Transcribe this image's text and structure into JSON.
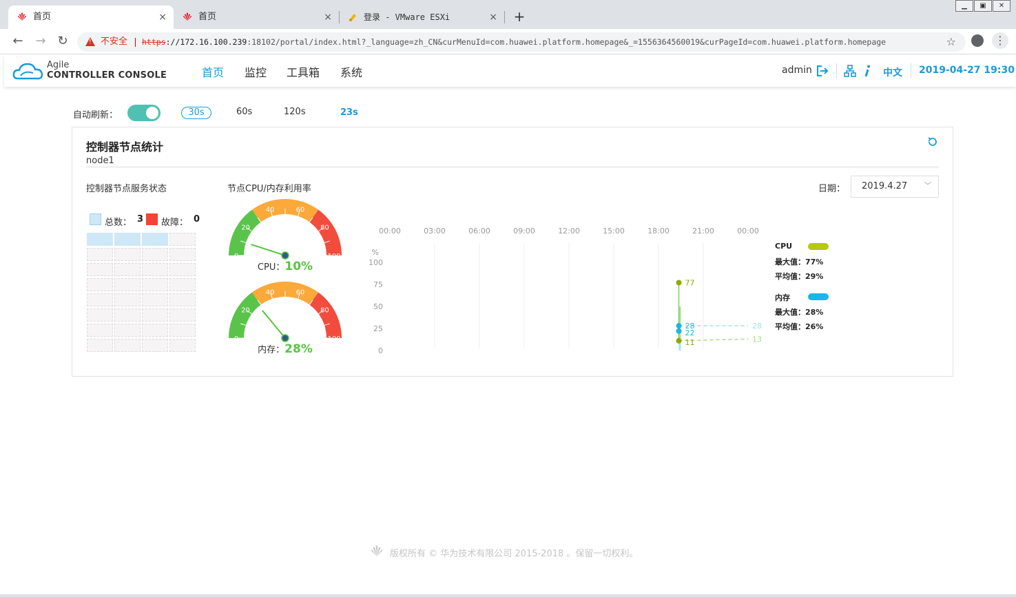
{
  "browser": {
    "tabs": [
      {
        "title": "首页",
        "active": true,
        "icon": "huawei-logo-icon"
      },
      {
        "title": "首页",
        "active": false,
        "icon": "huawei-logo-icon"
      },
      {
        "title": "登录 - VMware ESXi",
        "active": false,
        "icon": "vmware-icon"
      }
    ],
    "close_glyph": "×",
    "new_tab_glyph": "+",
    "security_label": "不安全",
    "url_scheme": "https",
    "url_host": "://172.16.100.239",
    "url_rest": ":18102/portal/index.html?_language=zh_CN&curMenuId=com.huawei.platform.homepage&_=1556364560019&curPageId=com.huawei.platform.homepage",
    "back_glyph": "←",
    "forward_glyph": "→",
    "reload_glyph": "↻",
    "star_glyph": "☆",
    "menu_glyph": "⋮"
  },
  "app": {
    "brand_line1": "Agile",
    "brand_line2": "CONTROLLER CONSOLE",
    "nav": [
      {
        "label": "首页",
        "active": true
      },
      {
        "label": "监控",
        "active": false
      },
      {
        "label": "工具箱",
        "active": false
      },
      {
        "label": "系统",
        "active": false
      }
    ],
    "user": "admin",
    "language": "中文",
    "datetime": "2019-04-27 19:30",
    "accent_color": "#1a9bd7"
  },
  "refresh": {
    "label": "自动刷新：",
    "enabled": true,
    "intervals": [
      "30s",
      "60s",
      "120s"
    ],
    "selected": "30s",
    "countdown": "23s"
  },
  "panel": {
    "title": "控制器节点统计",
    "node": "node1",
    "service_title": "控制器节点服务状态",
    "usage_title": "节点CPU/内存利用率",
    "date_label": "日期：",
    "date_value": "2019.4.27",
    "total_label": "总数：",
    "total": "3",
    "fault_label": "故障：",
    "fault": "0",
    "colors": {
      "total": "#cfe8f7",
      "fault": "#f44336"
    }
  },
  "gauges": [
    {
      "name": "CPU",
      "label": "CPU：",
      "value_text": "10%",
      "value": 10
    },
    {
      "name": "memory",
      "label": "内存：",
      "value_text": "28%",
      "value": 28
    }
  ],
  "gauge_ticks": [
    "0",
    "20",
    "40",
    "60",
    "80",
    "100"
  ],
  "chart_data": {
    "type": "line",
    "x_ticks": [
      "00:00",
      "03:00",
      "06:00",
      "09:00",
      "12:00",
      "15:00",
      "18:00",
      "21:00",
      "00:00"
    ],
    "y_unit": "%",
    "y_ticks": [
      "0",
      "25",
      "50",
      "75",
      "100"
    ],
    "ylim": [
      0,
      100
    ],
    "series": [
      {
        "name": "CPU",
        "color": "#b5c90e",
        "max_label": "最大值：77%",
        "avg_label": "平均值：29%",
        "points": [
          [
            "19:30",
            77
          ],
          [
            "19:30",
            11
          ]
        ],
        "dashed_to": 13,
        "labels": [
          "77",
          "11",
          "13"
        ]
      },
      {
        "name": "内存",
        "color": "#1ab6e8",
        "max_label": "最大值：28%",
        "avg_label": "平均值：26%",
        "points": [
          [
            "19:30",
            28
          ],
          [
            "19:30",
            22
          ]
        ],
        "dashed_to": 28,
        "labels": [
          "28",
          "22",
          "28"
        ]
      }
    ]
  },
  "footer": {
    "text": "版权所有 © 华为技术有限公司 2015-2018 。保留一切权利。"
  }
}
